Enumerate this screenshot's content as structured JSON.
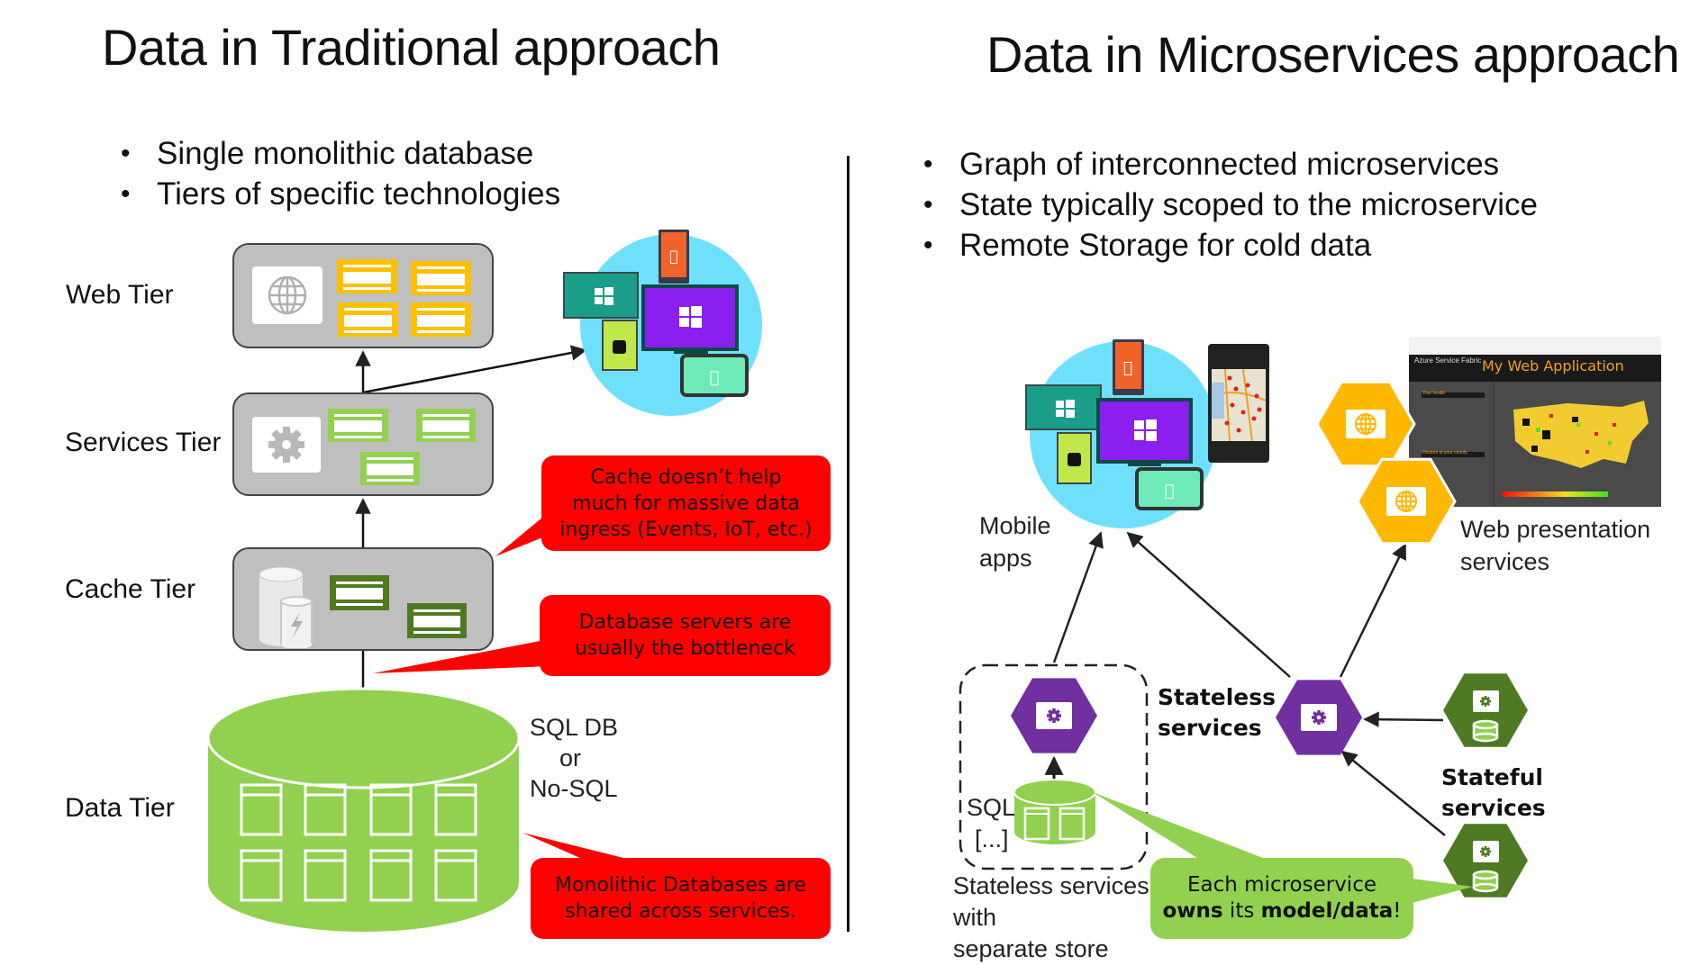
{
  "left": {
    "title": "Data in Traditional approach",
    "bullets": [
      "Single monolithic database",
      "Tiers of specific technologies"
    ],
    "tiers": {
      "web": "Web Tier",
      "services": "Services Tier",
      "cache": "Cache Tier",
      "data": "Data Tier"
    },
    "db_type": {
      "line1": "SQL DB",
      "line2": "or",
      "line3": "No-SQL"
    },
    "callouts": [
      {
        "line1": "Cache doesn’t help",
        "line2": "much for massive data",
        "line3": "ingress (Events, IoT, etc.)"
      },
      {
        "line1": "Database servers are",
        "line2": "usually the bottleneck"
      },
      {
        "line1": "Monolithic Databases are",
        "line2": "shared across services."
      }
    ]
  },
  "right": {
    "title": "Data in Microservices approach",
    "bullets": [
      "Graph of interconnected microservices",
      "State typically scoped to the microservice",
      "Remote Storage for cold data"
    ],
    "mobile_label": {
      "line1": "Mobile",
      "line2": "apps"
    },
    "web_label": {
      "line1": "Web presentation",
      "line2": "services"
    },
    "web_app_screenshot": {
      "header_small": "Azure Service Fabric",
      "app_title": "My Web Application",
      "panel_1": "Your health",
      "panel_2": "Doctors in your county"
    },
    "stateless_label": {
      "line1": "Stateless",
      "line2": "services"
    },
    "stateful_label": {
      "line1": "Stateful",
      "line2": "services"
    },
    "store_label": {
      "line1": "SQL",
      "line2": "[...]"
    },
    "separate_store_label": {
      "line1": "Stateless services",
      "line2": "with",
      "line3": "separate store"
    },
    "callout": {
      "line1": "Each microservice",
      "bold1": "owns",
      "mid": " its ",
      "bold2": "model/data",
      "end": "!"
    }
  },
  "colors": {
    "tier_gray": "#bfbfbf",
    "web_yellow": "#ffc000",
    "services_green": "#92d050",
    "cache_dark_green": "#4e7a23",
    "db_green": "#92d050",
    "callout_red": "#ff0000",
    "callout_green": "#92d050",
    "devices_circle": "#6fe0fc",
    "stateless_purple": "#7030a0",
    "stateful_green": "#4e7a23",
    "web_hex_yellow": "#ffb800"
  }
}
